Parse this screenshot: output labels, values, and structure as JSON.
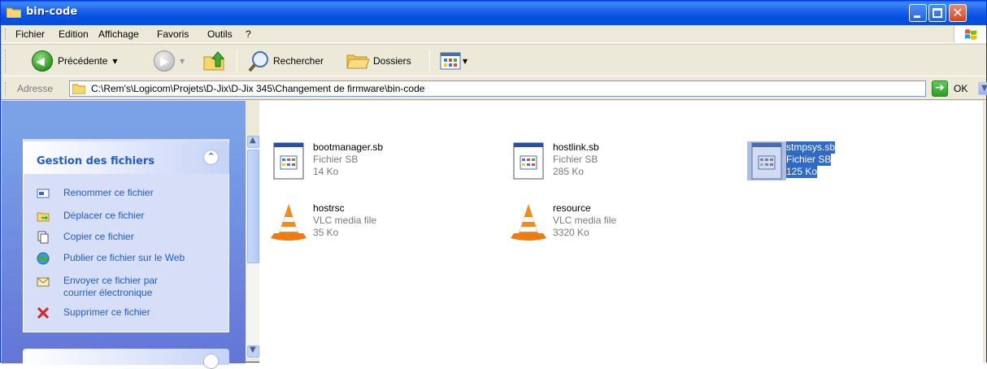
{
  "window": {
    "title": "bin-code"
  },
  "menu": [
    "Fichier",
    "Edition",
    "Affichage",
    "Favoris",
    "Outils",
    "?"
  ],
  "toolbar": {
    "back": "Précédente",
    "search": "Rechercher",
    "folders": "Dossiers"
  },
  "address": {
    "label": "Adresse",
    "path": "C:\\Rem's\\Logicom\\Projets\\D-Jix\\D-Jix 345\\Changement de firmware\\bin-code",
    "go": "OK"
  },
  "tasks": {
    "title": "Gestion des fichiers",
    "items": [
      {
        "label": "Renommer ce fichier",
        "icon": "rename-icon"
      },
      {
        "label": "Déplacer ce fichier",
        "icon": "move-icon"
      },
      {
        "label": "Copier ce fichier",
        "icon": "copy-icon"
      },
      {
        "label": "Publier ce fichier sur le Web",
        "icon": "publish-web-icon"
      },
      {
        "label": "Envoyer ce fichier par",
        "label2": "courrier électronique",
        "icon": "email-icon"
      },
      {
        "label": "Supprimer ce fichier",
        "icon": "delete-icon"
      }
    ]
  },
  "files": [
    {
      "name": "bootmanager.sb",
      "type": "Fichier SB",
      "size": "14 Ko",
      "icon": "sb-file-icon"
    },
    {
      "name": "hostlink.sb",
      "type": "Fichier SB",
      "size": "285 Ko",
      "icon": "sb-file-icon"
    },
    {
      "name": "stmpsys.sb",
      "type": "Fichier SB",
      "size": "125 Ko",
      "icon": "sb-file-icon",
      "selected": true
    },
    {
      "name": "hostrsc",
      "type": "VLC media file",
      "size": "35 Ko",
      "icon": "vlc-cone-icon"
    },
    {
      "name": "resource",
      "type": "VLC media file",
      "size": "3320 Ko",
      "icon": "vlc-cone-icon"
    }
  ],
  "colors": {
    "accent": "#316AC5",
    "taskpane": "#6375D6",
    "titlebar": "#0A5FE8"
  }
}
